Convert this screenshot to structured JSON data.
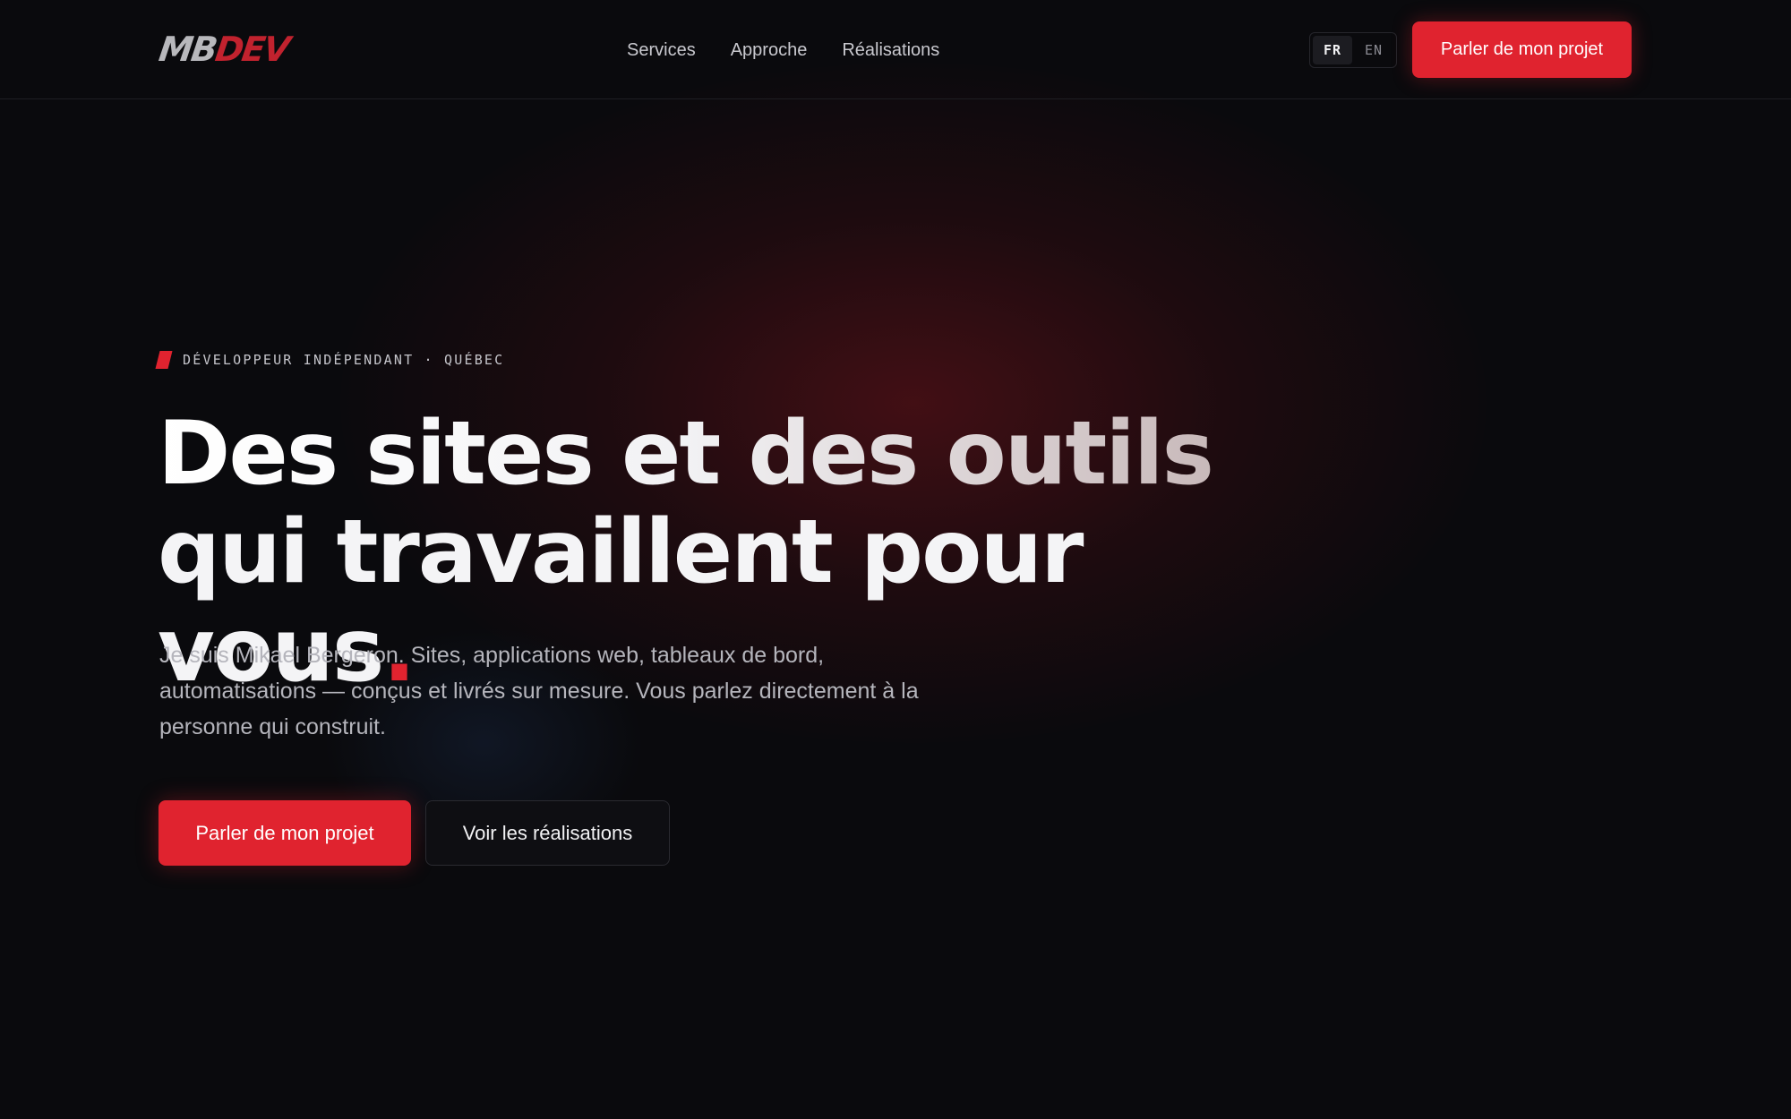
{
  "header": {
    "logo": {
      "part1": "MB",
      "part2": "DEV"
    },
    "nav": [
      {
        "label": "Services"
      },
      {
        "label": "Approche"
      },
      {
        "label": "Réalisations"
      }
    ],
    "lang": {
      "active": "FR",
      "inactive": "EN"
    },
    "cta": "Parler de mon projet"
  },
  "hero": {
    "eyebrow": "DÉVELOPPEUR INDÉPENDANT · QUÉBEC",
    "headline_line1": "Des sites et des outils",
    "headline_line2": "qui travaillent pour vous",
    "headline_dot": ".",
    "lede": "Je suis Mikael Bergeron. Sites, applications web, tableaux de bord, automatisations — conçus et livrés sur mesure. Vous parlez directement à la personne qui construit.",
    "primary_cta": "Parler de mon projet",
    "secondary_cta": "Voir les réalisations"
  },
  "colors": {
    "accent": "#e0232f",
    "background": "#0a0a0d",
    "text": "#f4f4f6",
    "muted": "#b5b5bc"
  }
}
